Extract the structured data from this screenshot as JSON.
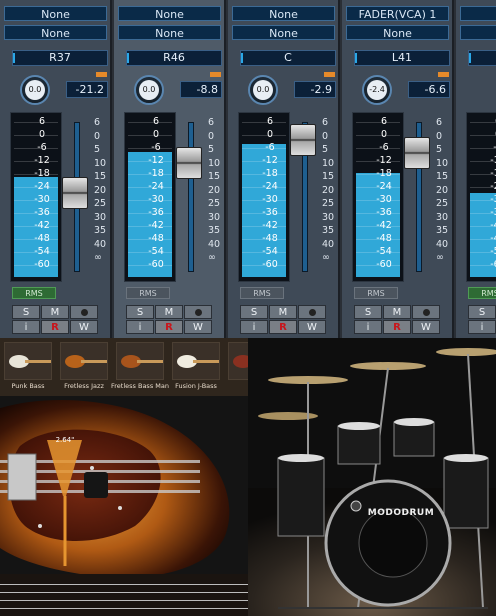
{
  "mixer": {
    "channels": [
      {
        "send1": "None",
        "send2": "None",
        "pan": "R37",
        "knob": "0.0",
        "volume": "-21.2",
        "level": 0.62,
        "fader": 0.48,
        "rms": "RMS",
        "rms_active": true,
        "btn_s": "S",
        "btn_m": "M",
        "btn_i": "i",
        "btn_r": "R",
        "btn_w": "W"
      },
      {
        "send1": "None",
        "send2": "None",
        "pan": "R46",
        "knob": "0.0",
        "volume": "-8.8",
        "level": 0.77,
        "fader": 0.28,
        "rms": "RMS",
        "rms_active": false,
        "btn_s": "S",
        "btn_m": "M",
        "btn_i": "i",
        "btn_r": "R",
        "btn_w": "W"
      },
      {
        "send1": "None",
        "send2": "None",
        "pan": "C",
        "knob": "0.0",
        "volume": "-2.9",
        "level": 0.82,
        "fader": 0.12,
        "rms": "RMS",
        "rms_active": false,
        "btn_s": "S",
        "btn_m": "M",
        "btn_i": "i",
        "btn_r": "R",
        "btn_w": "W"
      },
      {
        "send1": "FADER(VCA) 1",
        "send2": "None",
        "pan": "L41",
        "knob": "-2.4",
        "volume": "-6.6",
        "level": 0.64,
        "fader": 0.21,
        "rms": "RMS",
        "rms_active": false,
        "btn_s": "S",
        "btn_m": "M",
        "btn_i": "i",
        "btn_r": "R",
        "btn_w": "W"
      },
      {
        "send1": "FADI",
        "send2": "None",
        "pan": "",
        "knob": "",
        "volume": "",
        "level": 0.52,
        "fader": 0.3,
        "rms": "RMS",
        "rms_active": true,
        "btn_s": "S",
        "btn_m": "M",
        "btn_i": "i",
        "btn_r": "R",
        "btn_w": "W"
      }
    ],
    "meter_scale": [
      "6",
      "0",
      "-6",
      "-12",
      "-18",
      "-24",
      "-30",
      "-36",
      "-42",
      "-48",
      "-54",
      "-60"
    ],
    "fader_scale": [
      "6",
      "0",
      "5",
      "10",
      "15",
      "20",
      "25",
      "30",
      "35",
      "40",
      "∞"
    ]
  },
  "bass": {
    "presets": [
      "Punk Bass",
      "Fretless Jazz",
      "Fretless Bass Man",
      "Fusion J-Bass",
      "H"
    ],
    "preset_colors": [
      "#e8e4d8",
      "#b8621a",
      "#a8541c",
      "#f0ece0",
      "#8a3020"
    ],
    "fret_label": "2.64\""
  },
  "drums": {
    "logo_text": "MODODRUM"
  }
}
